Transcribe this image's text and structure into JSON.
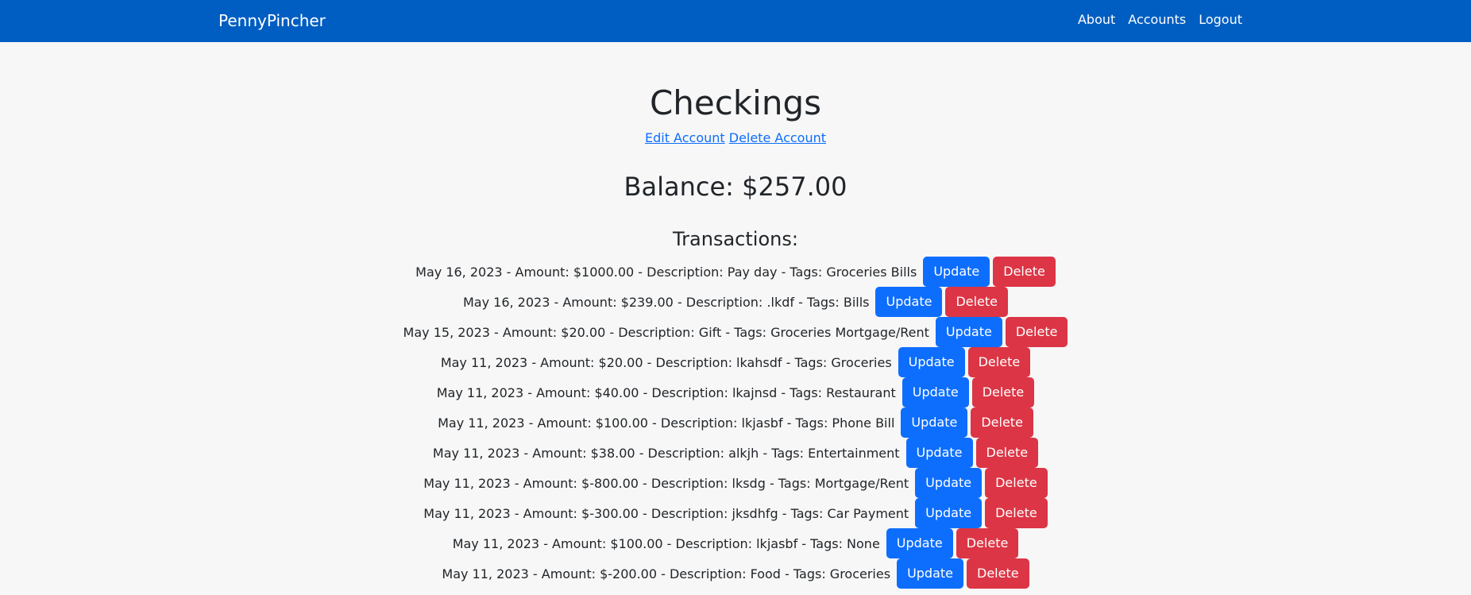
{
  "nav": {
    "brand": "PennyPincher",
    "links": [
      "About",
      "Accounts",
      "Logout"
    ]
  },
  "account": {
    "title": "Checkings",
    "edit_link": "Edit Account",
    "delete_link": "Delete Account",
    "balance": "Balance: $257.00"
  },
  "transactions": {
    "heading": "Transactions:",
    "update_label": "Update",
    "delete_label": "Delete",
    "items": [
      "May 16, 2023 - Amount: $1000.00 - Description: Pay day - Tags: Groceries Bills",
      "May 16, 2023 - Amount: $239.00 - Description: .lkdf - Tags: Bills",
      "May 15, 2023 - Amount: $20.00 - Description: Gift - Tags: Groceries Mortgage/Rent",
      "May 11, 2023 - Amount: $20.00 - Description: lkahsdf - Tags: Groceries",
      "May 11, 2023 - Amount: $40.00 - Description: lkajnsd - Tags: Restaurant",
      "May 11, 2023 - Amount: $100.00 - Description: lkjasbf - Tags: Phone Bill",
      "May 11, 2023 - Amount: $38.00 - Description: alkjh - Tags: Entertainment",
      "May 11, 2023 - Amount: $-800.00 - Description: lksdg - Tags: Mortgage/Rent",
      "May 11, 2023 - Amount: $-300.00 - Description: jksdhfg - Tags: Car Payment",
      "May 11, 2023 - Amount: $100.00 - Description: lkjasbf - Tags: None",
      "May 11, 2023 - Amount: $-200.00 - Description: Food - Tags: Groceries"
    ]
  },
  "colors": {
    "navbar": "#005ec2",
    "update_button": "#0d6efd",
    "delete_button": "#dc3545",
    "link": "#0d6efd"
  }
}
